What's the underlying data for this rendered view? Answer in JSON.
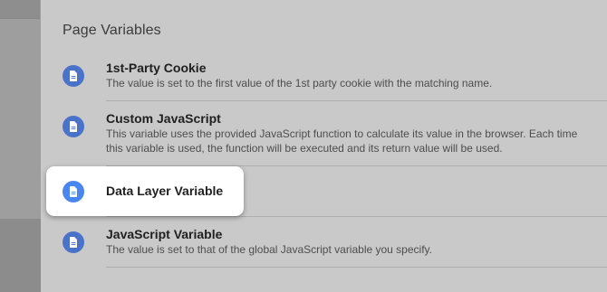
{
  "panel": {
    "section_title": "Page Variables",
    "items": [
      {
        "title": "1st-Party Cookie",
        "description": "The value is set to the first value of the 1st party cookie with the matching name.",
        "icon": "document-icon"
      },
      {
        "title": "Custom JavaScript",
        "description": "This variable uses the provided JavaScript function to calculate its value in the browser. Each time this variable is used, the function will be executed and its return value will be used.",
        "icon": "document-icon"
      },
      {
        "title": "Data Layer Variable",
        "description": "",
        "icon": "document-icon",
        "highlighted": true
      },
      {
        "title": "JavaScript Variable",
        "description": "The value is set to that of the global JavaScript variable you specify.",
        "icon": "document-icon"
      }
    ]
  },
  "colors": {
    "icon_blue": "#4a86f0",
    "icon_blue_dimmed": "#4a72c9",
    "panel_bg": "#c9c9c9",
    "highlight_bg": "#ffffff"
  }
}
